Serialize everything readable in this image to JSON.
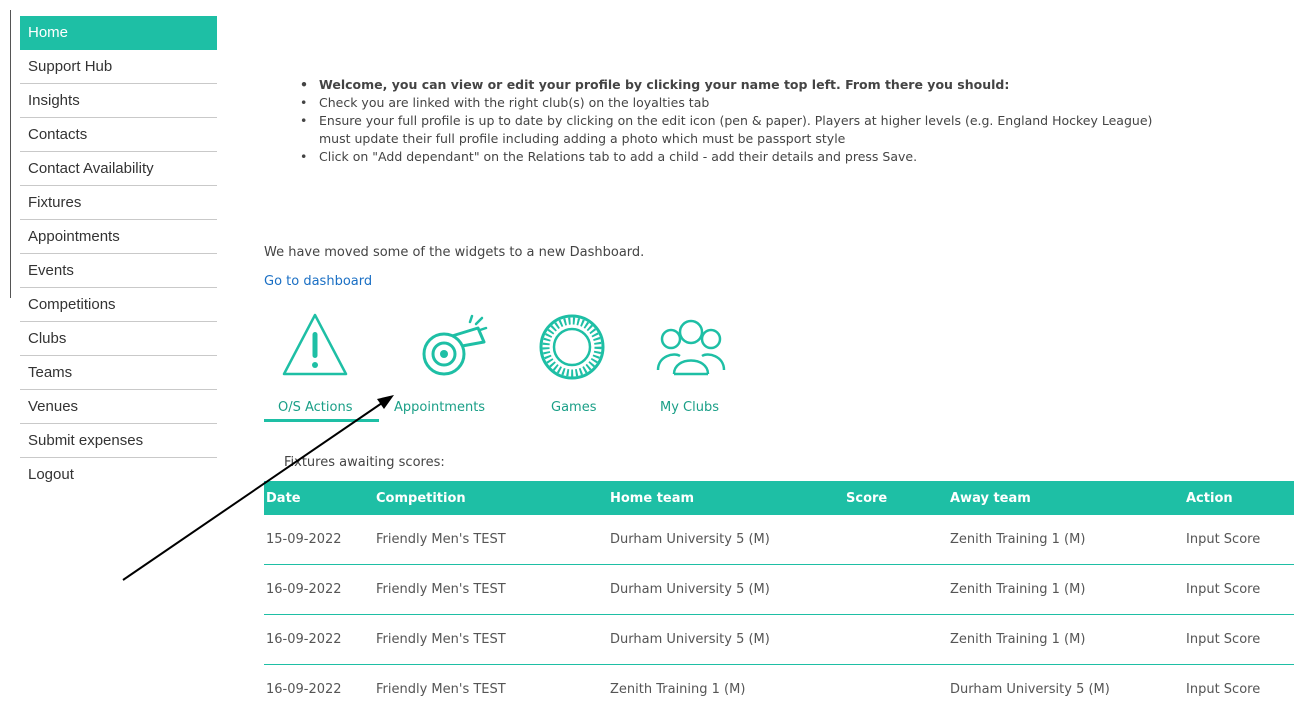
{
  "sidebar": {
    "items": [
      {
        "label": "Home",
        "active": true
      },
      {
        "label": "Support Hub"
      },
      {
        "label": "Insights"
      },
      {
        "label": "Contacts"
      },
      {
        "label": "Contact Availability"
      },
      {
        "label": "Fixtures"
      },
      {
        "label": "Appointments"
      },
      {
        "label": "Events"
      },
      {
        "label": "Competitions"
      },
      {
        "label": "Clubs"
      },
      {
        "label": "Teams"
      },
      {
        "label": "Venues"
      },
      {
        "label": "Submit expenses"
      },
      {
        "label": "Logout"
      }
    ]
  },
  "welcome": {
    "bullets": [
      "Welcome, you can view or edit your profile by clicking your name top left. From there you should:",
      "Check you are linked with the right club(s) on the loyalties tab",
      "Ensure your full profile is up to date by clicking on the edit icon (pen & paper). Players at higher levels (e.g. England Hockey League)",
      "must update their full profile including adding a photo which must be passport style",
      "Click on \"Add dependant\" on the Relations tab to add a child - add their details and press Save."
    ]
  },
  "dashboard": {
    "moved_text": "We have moved some of the widgets to a new Dashboard.",
    "link": "Go to dashboard"
  },
  "widgets": {
    "items": [
      {
        "label": "O/S Actions",
        "icon": "warning-triangle-icon"
      },
      {
        "label": "Appointments",
        "icon": "whistle-icon"
      },
      {
        "label": "Games",
        "icon": "ball-icon"
      },
      {
        "label": "My Clubs",
        "icon": "people-group-icon"
      }
    ]
  },
  "fixtures": {
    "title": "Fixtures awaiting scores:",
    "columns": [
      "Date",
      "Competition",
      "Home team",
      "Score",
      "Away team",
      "Action"
    ],
    "rows": [
      {
        "date": "15-09-2022",
        "competition": "Friendly Men's TEST",
        "home": "Durham University 5 (M)",
        "score": "",
        "away": "Zenith Training 1 (M)",
        "action": "Input Score"
      },
      {
        "date": "16-09-2022",
        "competition": "Friendly Men's TEST",
        "home": "Durham University 5 (M)",
        "score": "",
        "away": "Zenith Training 1 (M)",
        "action": "Input Score"
      },
      {
        "date": "16-09-2022",
        "competition": "Friendly Men's TEST",
        "home": "Durham University 5 (M)",
        "score": "",
        "away": "Zenith Training 1 (M)",
        "action": "Input Score"
      },
      {
        "date": "16-09-2022",
        "competition": "Friendly Men's TEST",
        "home": "Zenith Training 1 (M)",
        "score": "",
        "away": "Durham University 5 (M)",
        "action": "Input Score"
      }
    ]
  },
  "colors": {
    "accent": "#1ebfa5",
    "link": "#1a6fc4"
  }
}
